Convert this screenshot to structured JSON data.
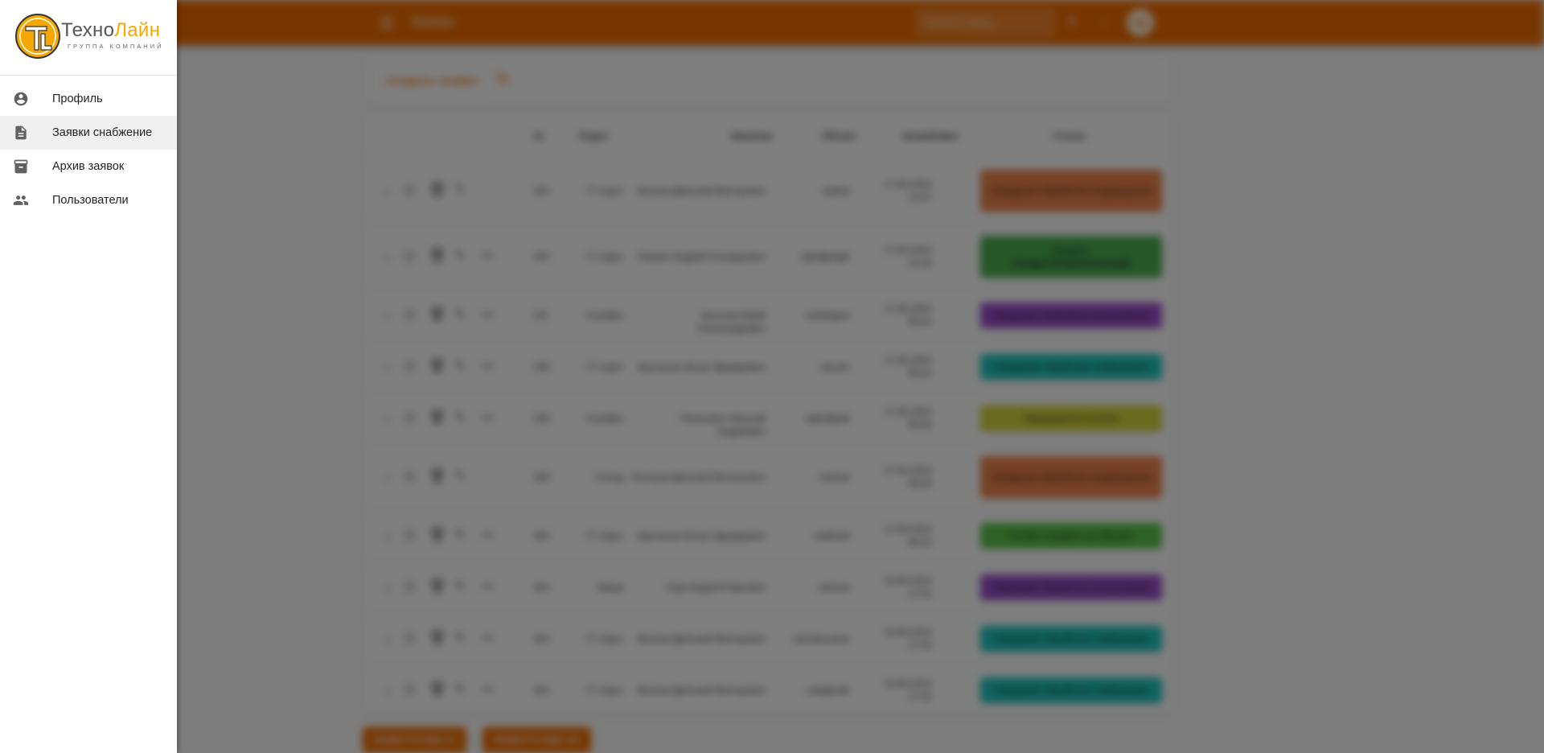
{
  "header": {
    "title": "Заявки",
    "search_placeholder": "Начните ввод...",
    "avatar_initials": "КД",
    "accent_color": "#ef6c00"
  },
  "toolbar": {
    "create_label": "СОЗДАТЬ ЗАЯВКУ"
  },
  "table": {
    "columns": [
      "№",
      "Отдел",
      "Заказчик",
      "Объект",
      "Затребовал",
      "Статус"
    ],
    "rows": [
      {
        "num": "333",
        "dept": "IT отдел",
        "customer": "Волков Дмитрий Викторович",
        "object": "sdafsd",
        "date": "17.05.2024",
        "time": "11:47",
        "status": "Ожидание обработки кладовщиком",
        "status_bold": "",
        "color": "#f0834a",
        "extra_action": false
      },
      {
        "num": "332",
        "dept": "IT отдел",
        "customer": "Панкин Андрей Геннадьевич",
        "object": "fghdfghdgh",
        "date": "17.05.2024",
        "time": "10:16",
        "status": "Выдано",
        "status_bold": "Склад 3 (Строительный)",
        "color": "#4caf50",
        "extra_action": true
      },
      {
        "num": "331",
        "dept": "Стройка",
        "customer": "Киселев Юрий Александрович",
        "object": "swfsfsgsef",
        "date": "17.05.2024",
        "time": "09:44",
        "status": "Ожидание обработки контролёром",
        "status_bold": "",
        "color": "#9c4dcc",
        "extra_action": true
      },
      {
        "num": "330",
        "dept": "IT отдел",
        "customer": "Арутюнов Артур Эдуардович",
        "object": "sdcsdc",
        "date": "17.05.2024",
        "time": "09:43",
        "status": "Ожидание обработки снабжением",
        "status_bold": "",
        "color": "#1ec8c0",
        "extra_action": true
      },
      {
        "num": "329",
        "dept": "Стройка",
        "customer": "Панишкин Николай Андреевич",
        "object": "dgfsdfgsdf",
        "date": "17.05.2024",
        "time": "09:30",
        "status": "Проверяется остаток",
        "status_bold": "",
        "color": "#d4d63a",
        "extra_action": true
      },
      {
        "num": "328",
        "dept": "Склад",
        "customer": "Кольцов Дмитрий Витальевич",
        "object": "asdasd",
        "date": "17.05.2024",
        "time": "09:29",
        "status": "Ожидание обработки кладовщиком",
        "status_bold": "",
        "color": "#f0834a",
        "extra_action": false
      },
      {
        "num": "326",
        "dept": "IT отдел",
        "customer": "Арутюнов Артур Эдуардович",
        "object": "sadfasdf",
        "date": "17.05.2024",
        "time": "09:22",
        "status": "Готово к выдаче на объекте",
        "status_bold": "",
        "color": "#5cc44a",
        "extra_action": true
      },
      {
        "num": "324",
        "dept": "Завод",
        "customer": "Года Андрей Юрьевич",
        "object": "adsasd",
        "date": "15.05.2024",
        "time": "17:51",
        "status": "Ожидание обработки контролёром",
        "status_bold": "",
        "color": "#9c4dcc",
        "extra_action": true
      },
      {
        "num": "323",
        "dept": "IT отдел",
        "customer": "Волков Дмитрий Викторович",
        "object": "вмсвмсымсв",
        "date": "15.05.2024",
        "time": "17:34",
        "status": "Ожидание обработки снабжением",
        "status_bold": "",
        "color": "#1ec8c0",
        "extra_action": true
      },
      {
        "num": "322",
        "dept": "IT отдел",
        "customer": "Волков Дмитрий Викторович",
        "object": "ывафывм",
        "date": "15.05.2024",
        "time": "17:33",
        "status": "Ожидание обработки снабжением",
        "status_bold": "",
        "color": "#1ec8c0",
        "extra_action": true
      }
    ]
  },
  "load_more": {
    "btn10": "ВЫВЕСТИ ЕЩЕ 10",
    "btn100": "ВЫВЕСТИ ЕЩЕ 100"
  },
  "drawer": {
    "logo_main_1": "Техно",
    "logo_main_2": "Лайн",
    "logo_sub": "ГРУППА КОМПАНИЙ",
    "items": [
      {
        "label": "Профиль",
        "icon": "account-circle-icon",
        "active": false
      },
      {
        "label": "Заявки снабжение",
        "icon": "file-document-icon",
        "active": true
      },
      {
        "label": "Архив заявок",
        "icon": "archive-icon",
        "active": false
      },
      {
        "label": "Пользователи",
        "icon": "users-icon",
        "active": false
      }
    ]
  }
}
